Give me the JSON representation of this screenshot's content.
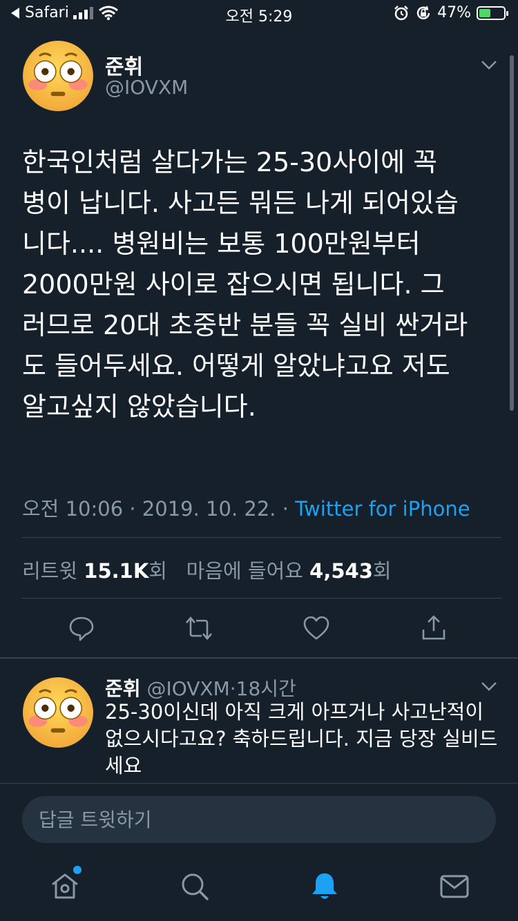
{
  "status_bar": {
    "carrier": "Safari",
    "time": "오전 5:29",
    "battery": "47%",
    "battery_level": 0.47,
    "icons": [
      "back-arrow-icon",
      "signal-icon",
      "wifi-icon",
      "alarm-icon",
      "rotation-lock-icon",
      "battery-icon"
    ]
  },
  "tweet": {
    "name": "준휘",
    "handle": "@IOVXM",
    "text": "한국인처럼 살다가는 25-30사이에 꼭\n병이 납니다. 사고든 뭐든 나게 되어있습\n니다.... 병원비는 보통 100만원부터\n2000만원 사이로 잡으시면 됩니다. 그\n러므로 20대 초중반 분들 꼭 실비 싼거라\n도 들어두세요. 어떻게 알았냐고요 저도\n알고싶지 않았습니다.",
    "timestamp": "오전 10:06 · 2019. 10. 22. · ",
    "source": "Twitter for iPhone",
    "retweets_label": "리트윗",
    "retweets_count": "15.1K",
    "retweets_suffix": "회",
    "likes_label": "마음에 들어요",
    "likes_count": "4,543",
    "likes_suffix": "회",
    "actions": [
      "reply-icon",
      "retweet-icon",
      "like-icon",
      "share-icon"
    ]
  },
  "reply": {
    "name": "준휘",
    "handle": "@IOVXM",
    "separator": "·",
    "time": "18시간",
    "text": "25-30이신데 아직 크게 아프거나 사고난적이 없으시다고요? 축하드립니다. 지금 당장 실비드세요"
  },
  "composer": {
    "placeholder": "답글 트윗하기"
  },
  "tabbar": {
    "items": [
      "home-icon",
      "search-icon",
      "notifications-icon",
      "messages-icon"
    ],
    "active": "notifications-icon"
  },
  "colors": {
    "background": "#15202b",
    "accent": "#1da1f2",
    "muted": "#8899a6",
    "divider": "#38444d"
  }
}
